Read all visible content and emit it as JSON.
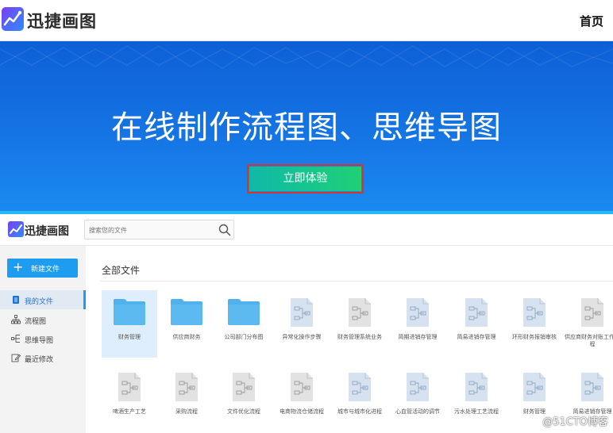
{
  "site": {
    "brand": "迅捷画图",
    "home_link": "首页"
  },
  "hero": {
    "title": "在线制作流程图、思维导图",
    "cta_label": "立即体验"
  },
  "app": {
    "brand": "迅捷画图",
    "search": {
      "placeholder": "搜索您的文件"
    },
    "new_file_label": "新建文件",
    "nav": [
      {
        "label": "我的文件",
        "icon": "file-icon",
        "active": true
      },
      {
        "label": "流程图",
        "icon": "flowchart-icon",
        "active": false
      },
      {
        "label": "思维导图",
        "icon": "mindmap-icon",
        "active": false
      },
      {
        "label": "最近修改",
        "icon": "edit-icon",
        "active": false
      }
    ],
    "section_title": "全部文件",
    "files_row1": [
      {
        "name": "财务管理",
        "kind": "folder"
      },
      {
        "name": "供应商财务",
        "kind": "folder"
      },
      {
        "name": "公司部门分布图",
        "kind": "folder"
      },
      {
        "name": "异常化操作步骤",
        "kind": "flowchart"
      },
      {
        "name": "财务管理系统业务",
        "kind": "flowchart-gray"
      },
      {
        "name": "简期进销存管理",
        "kind": "flowchart"
      },
      {
        "name": "简易进销存管理",
        "kind": "flowchart"
      },
      {
        "name": "环形财务报销审核",
        "kind": "flowchart"
      },
      {
        "name": "供应商财务对账工作流程",
        "kind": "flowchart-gray"
      }
    ],
    "files_row2": [
      {
        "name": "啤酒生产工艺",
        "kind": "flowchart-gray"
      },
      {
        "name": "采购流程",
        "kind": "flowchart-gray"
      },
      {
        "name": "文件优化流程",
        "kind": "flowchart-gray"
      },
      {
        "name": "电商物流仓储流程",
        "kind": "flowchart-gray"
      },
      {
        "name": "城市与城市化进程",
        "kind": "flowchart"
      },
      {
        "name": "心血管活动的调节",
        "kind": "flowchart"
      },
      {
        "name": "污水处理工艺流程",
        "kind": "flowchart"
      },
      {
        "name": "财务管理",
        "kind": "flowchart"
      },
      {
        "name": "简易进销存管理",
        "kind": "flowchart"
      }
    ]
  },
  "watermark": "@51CTO博客",
  "colors": {
    "hero_blue": "#1677e6",
    "accent": "#1e9cf0",
    "cta_green": "#1fd076",
    "cta_outline": "#d8352a",
    "folder_blue": "#4fb2ec",
    "doc_gray": "#d9dee5"
  }
}
